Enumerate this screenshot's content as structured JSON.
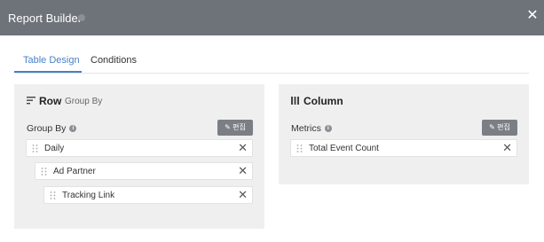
{
  "dialog": {
    "title": "Report Builder",
    "close_icon": "close-icon"
  },
  "tabs": [
    {
      "label": "Table Design",
      "active": true
    },
    {
      "label": "Conditions",
      "active": false
    }
  ],
  "row_panel": {
    "title": "Row",
    "subtitle": "Group By",
    "icon": "sort-lines-icon",
    "section_label": "Group By",
    "edit_label": "편집",
    "items": [
      {
        "label": "Daily"
      },
      {
        "label": "Ad Partner"
      },
      {
        "label": "Tracking Link"
      }
    ]
  },
  "column_panel": {
    "title": "Column",
    "icon": "column-bars-icon",
    "section_label": "Metrics",
    "edit_label": "편집",
    "items": [
      {
        "label": "Total Event Count"
      }
    ]
  },
  "colors": {
    "titlebar": "#6e737a",
    "accent": "#4a7fc7",
    "panel": "#efefef",
    "button": "#7b7f85"
  }
}
